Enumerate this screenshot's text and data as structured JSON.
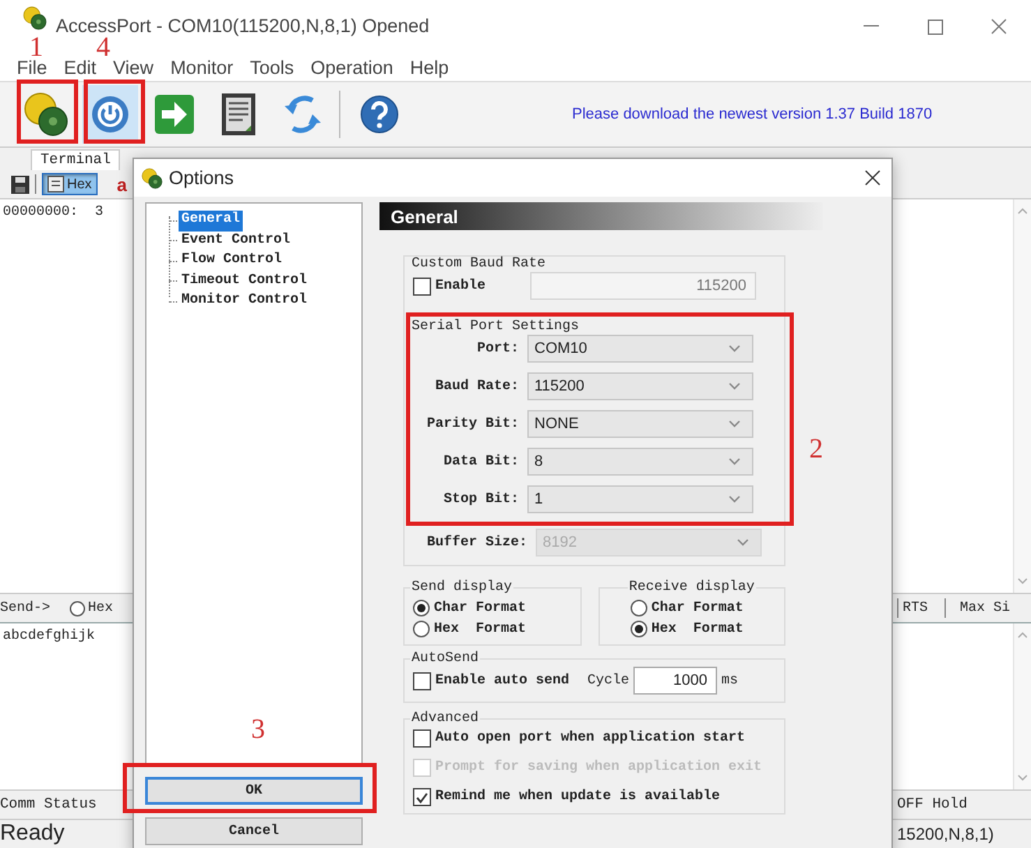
{
  "window": {
    "title": "AccessPort - COM10(115200,N,8,1) Opened"
  },
  "menu": [
    "File",
    "Edit",
    "View",
    "Monitor",
    "Tools",
    "Operation",
    "Help"
  ],
  "toolbar": {
    "buttons": [
      {
        "kind": "gears",
        "pressed": false
      },
      {
        "kind": "power",
        "pressed": true
      },
      {
        "kind": "arrow",
        "pressed": false
      },
      {
        "kind": "document",
        "pressed": false
      },
      {
        "kind": "refresh",
        "pressed": false
      },
      {
        "kind": "help",
        "pressed": false
      }
    ],
    "notice": "Please download the newest version 1.37 Build 1870"
  },
  "tabs": [
    {
      "label": "Terminal",
      "selected": true
    }
  ],
  "terminal_toolbar": {
    "hex_toggle": {
      "label": "Hex",
      "pressed": true
    },
    "cut_text": "a"
  },
  "receive_area": {
    "line": "00000000:  3"
  },
  "send_bar": {
    "label": "Send->",
    "hex_option": {
      "label": "Hex",
      "selected": false
    },
    "rts": "RTS",
    "max_size": "Max Si"
  },
  "send_text": "abcdefghijk",
  "status_bar": {
    "comm_status": "Comm Status",
    "line_state": "OFF Hold",
    "state": "Ready",
    "settings": "15200,N,8,1)"
  },
  "dialog": {
    "title": "Options",
    "tree": [
      {
        "label": "General",
        "selected": true
      },
      {
        "label": "Event Control",
        "selected": false
      },
      {
        "label": "Flow Control",
        "selected": false
      },
      {
        "label": "Timeout Control",
        "selected": false
      },
      {
        "label": "Monitor Control",
        "selected": false
      }
    ],
    "header": "General",
    "custom_baud": {
      "title": "Custom Baud Rate",
      "enable": {
        "label": "Enable",
        "checked": false
      },
      "value": "115200",
      "disabled": true
    },
    "serial": {
      "title": "Serial Port Settings",
      "fields": [
        {
          "label": "Port:",
          "value": "COM10"
        },
        {
          "label": "Baud Rate:",
          "value": "115200"
        },
        {
          "label": "Parity Bit:",
          "value": "NONE"
        },
        {
          "label": "Data Bit:",
          "value": "8"
        },
        {
          "label": "Stop Bit:",
          "value": "1"
        }
      ]
    },
    "buffer_size": {
      "label": "Buffer Size:",
      "value": "8192",
      "disabled": true
    },
    "send_display": {
      "title": "Send display",
      "options": [
        {
          "label": "Char Format",
          "selected": true
        },
        {
          "label": "Hex  Format",
          "selected": false
        }
      ]
    },
    "receive_display": {
      "title": "Receive display",
      "options": [
        {
          "label": "Char Format",
          "selected": false
        },
        {
          "label": "Hex  Format",
          "selected": true
        }
      ]
    },
    "autosend": {
      "title": "AutoSend",
      "enable": {
        "label": "Enable auto send",
        "checked": false
      },
      "cycle_label": "Cycle",
      "cycle": "1000",
      "unit": "ms"
    },
    "advanced": {
      "title": "Advanced",
      "options": [
        {
          "label": "Auto open port when application start",
          "checked": false,
          "disabled": false
        },
        {
          "label": "Prompt for saving when application exit",
          "checked": false,
          "disabled": true
        },
        {
          "label": "Remind me when update is available",
          "checked": true,
          "disabled": false
        }
      ]
    },
    "buttons": [
      {
        "label": "OK",
        "default": true
      },
      {
        "label": "Cancel",
        "default": false
      }
    ]
  },
  "annotations": [
    {
      "number": "1"
    },
    {
      "number": "4"
    },
    {
      "number": "2"
    },
    {
      "number": "3"
    }
  ]
}
